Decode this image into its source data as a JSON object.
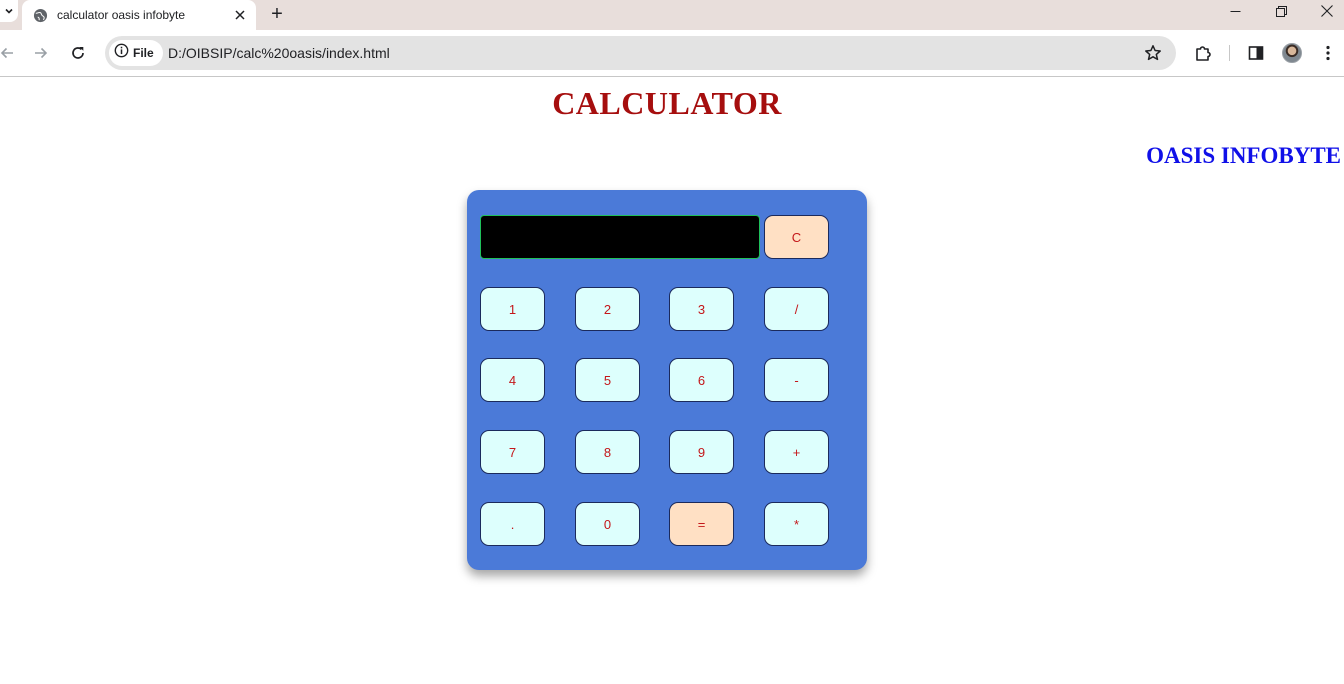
{
  "browser": {
    "tab_title": "calculator oasis infobyte",
    "new_tab_label": "+",
    "site_chip_label": "File",
    "url": "D:/OIBSIP/calc%20oasis/index.html"
  },
  "page": {
    "title": "CALCULATOR",
    "brand": "OASIS INFOBYTE"
  },
  "calculator": {
    "display_value": "",
    "clear_label": "C",
    "keys": [
      {
        "label": "1",
        "name": "key-1"
      },
      {
        "label": "2",
        "name": "key-2"
      },
      {
        "label": "3",
        "name": "key-3"
      },
      {
        "label": "/",
        "name": "key-divide"
      },
      {
        "label": "4",
        "name": "key-4"
      },
      {
        "label": "5",
        "name": "key-5"
      },
      {
        "label": "6",
        "name": "key-6"
      },
      {
        "label": "-",
        "name": "key-minus"
      },
      {
        "label": "7",
        "name": "key-7"
      },
      {
        "label": "8",
        "name": "key-8"
      },
      {
        "label": "9",
        "name": "key-9"
      },
      {
        "label": "+",
        "name": "key-plus"
      },
      {
        "label": ".",
        "name": "key-decimal"
      },
      {
        "label": "0",
        "name": "key-0"
      },
      {
        "label": "=",
        "name": "key-equals"
      },
      {
        "label": "*",
        "name": "key-multiply"
      }
    ]
  },
  "colors": {
    "title": "#a60e0e",
    "brand": "#1010e8",
    "calculator_body": "#4b7ad8",
    "key_background": "#ddfffd",
    "accent_key_background": "#ffe0c4",
    "key_text": "#c4171a",
    "display_background": "#000000"
  }
}
